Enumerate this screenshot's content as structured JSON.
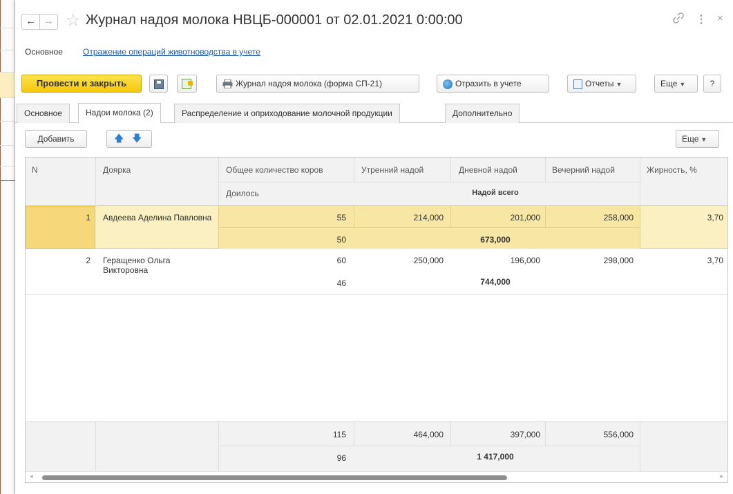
{
  "window": {
    "title": "Журнал надоя молока НВЦБ-000001 от 02.01.2021 0:00:00",
    "back_icon": "←",
    "forward_icon": "→",
    "star_icon": "☆",
    "link_icon": "🔗",
    "more_icon": "⋮",
    "close_icon": "×"
  },
  "subnav": {
    "main": "Основное",
    "link": "Отражение операций животноводства в учете"
  },
  "toolbar": {
    "post_close": "Провести и закрыть",
    "print_form": "Журнал надоя молока (форма СП-21)",
    "reflect": "Отразить в учете",
    "reports": "Отчеты",
    "more": "Еще",
    "help": "?"
  },
  "tabs": [
    {
      "label": "Основное"
    },
    {
      "label": "Надои молока (2)"
    },
    {
      "label": "Распределение и оприходование молочной продукции"
    },
    {
      "label": "Дополнительно"
    }
  ],
  "table_toolbar": {
    "add": "Добавить",
    "up_icon": "🡅",
    "down_icon": "🡇",
    "more": "Еще"
  },
  "grid": {
    "headers": {
      "n": "N",
      "milkmaid": "Доярка",
      "total_cows": "Общее количество коров",
      "milking": "Доилось",
      "morning": "Утренний надой",
      "day": "Дневной надой",
      "evening": "Вечерний надой",
      "total_yield": "Надой всего",
      "fat": "Жирность, %"
    },
    "rows": [
      {
        "n": "1",
        "milkmaid": "Авдеева Аделина Павловна",
        "total_cows": "55",
        "milking": "50",
        "morning": "214,000",
        "day": "201,000",
        "evening": "258,000",
        "total": "673,000",
        "fat": "3,70"
      },
      {
        "n": "2",
        "milkmaid": "Геращенко Ольга Викторовна",
        "total_cows": "60",
        "milking": "46",
        "morning": "250,000",
        "day": "196,000",
        "evening": "298,000",
        "total": "744,000",
        "fat": "3,70"
      }
    ],
    "footer": {
      "total_cows": "115",
      "milking": "96",
      "morning": "464,000",
      "day": "397,000",
      "evening": "556,000",
      "total": "1 417,000"
    }
  },
  "colors": {
    "primary_button": "#f5c70a",
    "selected_row": "#fbf0c2",
    "link": "#1a5aa8"
  }
}
